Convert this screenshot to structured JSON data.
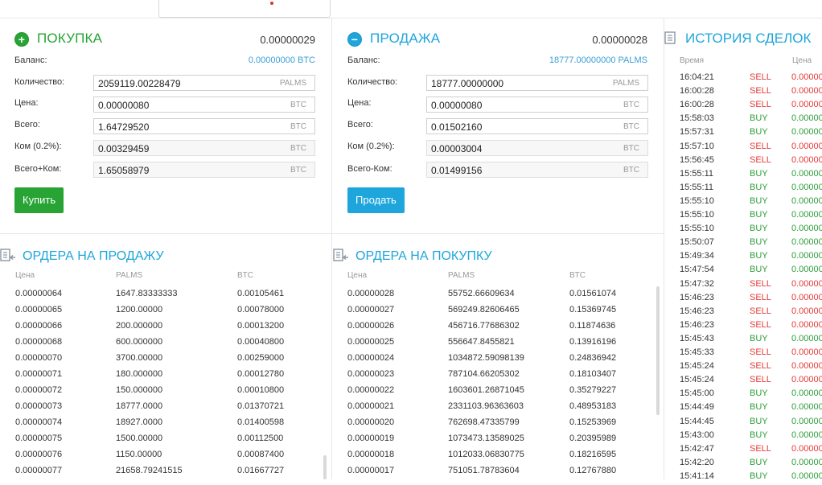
{
  "buy": {
    "title": "ПОКУПКА",
    "best_price": "0.00000029",
    "balance_label": "Баланс:",
    "balance_value": "0.00000000 BTC",
    "rows": [
      {
        "label": "Количество:",
        "value": "2059119.00228479",
        "unit": "PALMS"
      },
      {
        "label": "Цена:",
        "value": "0.00000080",
        "unit": "BTC"
      },
      {
        "label": "Всего:",
        "value": "1.64729520",
        "unit": "BTC"
      },
      {
        "label": "Ком (0.2%):",
        "value": "0.00329459",
        "unit": "BTC"
      },
      {
        "label": "Всего+Ком:",
        "value": "1.65058979",
        "unit": "BTC"
      }
    ],
    "button": "Купить"
  },
  "sell": {
    "title": "ПРОДАЖА",
    "best_price": "0.00000028",
    "balance_label": "Баланс:",
    "balance_value": "18777.00000000 PALMS",
    "rows": [
      {
        "label": "Количество:",
        "value": "18777.00000000",
        "unit": "PALMS"
      },
      {
        "label": "Цена:",
        "value": "0.00000080",
        "unit": "BTC"
      },
      {
        "label": "Всего:",
        "value": "0.01502160",
        "unit": "BTC"
      },
      {
        "label": "Ком (0.2%):",
        "value": "0.00003004",
        "unit": "BTC"
      },
      {
        "label": "Всего-Ком:",
        "value": "0.01499156",
        "unit": "BTC"
      }
    ],
    "button": "Продать"
  },
  "asks": {
    "title": "ОРДЕРА НА ПРОДАЖУ",
    "headers": [
      "Цена",
      "PALMS",
      "BTC"
    ],
    "rows": [
      [
        "0.00000064",
        "1647.83333333",
        "0.00105461"
      ],
      [
        "0.00000065",
        "1200.00000",
        "0.00078000"
      ],
      [
        "0.00000066",
        "200.000000",
        "0.00013200"
      ],
      [
        "0.00000068",
        "600.000000",
        "0.00040800"
      ],
      [
        "0.00000070",
        "3700.00000",
        "0.00259000"
      ],
      [
        "0.00000071",
        "180.000000",
        "0.00012780"
      ],
      [
        "0.00000072",
        "150.000000",
        "0.00010800"
      ],
      [
        "0.00000073",
        "18777.0000",
        "0.01370721"
      ],
      [
        "0.00000074",
        "18927.0000",
        "0.01400598"
      ],
      [
        "0.00000075",
        "1500.00000",
        "0.00112500"
      ],
      [
        "0.00000076",
        "1150.00000",
        "0.00087400"
      ],
      [
        "0.00000077",
        "21658.79241515",
        "0.01667727"
      ]
    ]
  },
  "bids": {
    "title": "ОРДЕРА НА ПОКУПКУ",
    "headers": [
      "Цена",
      "PALMS",
      "BTC"
    ],
    "rows": [
      [
        "0.00000028",
        "55752.66609634",
        "0.01561074"
      ],
      [
        "0.00000027",
        "569249.82606465",
        "0.15369745"
      ],
      [
        "0.00000026",
        "456716.77686302",
        "0.11874636"
      ],
      [
        "0.00000025",
        "556647.8455821",
        "0.13916196"
      ],
      [
        "0.00000024",
        "1034872.59098139",
        "0.24836942"
      ],
      [
        "0.00000023",
        "787104.66205302",
        "0.18103407"
      ],
      [
        "0.00000022",
        "1603601.26871045",
        "0.35279227"
      ],
      [
        "0.00000021",
        "2331103.96363603",
        "0.48953183"
      ],
      [
        "0.00000020",
        "762698.47335799",
        "0.15253969"
      ],
      [
        "0.00000019",
        "1073473.13589025",
        "0.20395989"
      ],
      [
        "0.00000018",
        "1012033.06830775",
        "0.18216595"
      ],
      [
        "0.00000017",
        "751051.78783604",
        "0.12767880"
      ]
    ]
  },
  "history": {
    "title": "ИСТОРИЯ СДЕЛОК",
    "headers": [
      "Время",
      "",
      "Цена"
    ],
    "rows": [
      [
        "16:04:21",
        "SELL",
        "0.00000"
      ],
      [
        "16:00:28",
        "SELL",
        "0.00000"
      ],
      [
        "16:00:28",
        "SELL",
        "0.00000"
      ],
      [
        "15:58:03",
        "BUY",
        "0.00000"
      ],
      [
        "15:57:31",
        "BUY",
        "0.00000"
      ],
      [
        "15:57:10",
        "SELL",
        "0.00000"
      ],
      [
        "15:56:45",
        "SELL",
        "0.00000"
      ],
      [
        "15:55:11",
        "BUY",
        "0.00000"
      ],
      [
        "15:55:11",
        "BUY",
        "0.00000"
      ],
      [
        "15:55:10",
        "BUY",
        "0.00000"
      ],
      [
        "15:55:10",
        "BUY",
        "0.00000"
      ],
      [
        "15:55:10",
        "BUY",
        "0.00000"
      ],
      [
        "15:50:07",
        "BUY",
        "0.00000"
      ],
      [
        "15:49:34",
        "BUY",
        "0.00000"
      ],
      [
        "15:47:54",
        "BUY",
        "0.00000"
      ],
      [
        "15:47:32",
        "SELL",
        "0.00000"
      ],
      [
        "15:46:23",
        "SELL",
        "0.00000"
      ],
      [
        "15:46:23",
        "SELL",
        "0.00000"
      ],
      [
        "15:46:23",
        "SELL",
        "0.00000"
      ],
      [
        "15:45:43",
        "BUY",
        "0.00000"
      ],
      [
        "15:45:33",
        "SELL",
        "0.00000"
      ],
      [
        "15:45:24",
        "SELL",
        "0.00000"
      ],
      [
        "15:45:24",
        "SELL",
        "0.00000"
      ],
      [
        "15:45:00",
        "BUY",
        "0.00000"
      ],
      [
        "15:44:49",
        "BUY",
        "0.00000"
      ],
      [
        "15:44:45",
        "BUY",
        "0.00000"
      ],
      [
        "15:43:00",
        "BUY",
        "0.00000"
      ],
      [
        "15:42:47",
        "SELL",
        "0.00000"
      ],
      [
        "15:42:20",
        "BUY",
        "0.00000"
      ],
      [
        "15:41:14",
        "BUY",
        "0.00000"
      ]
    ]
  },
  "colors": {
    "buy": "#27a434",
    "sell_accent": "#1ea6dc",
    "sell_trade": "#e53935",
    "buy_trade": "#2e9e3a"
  }
}
